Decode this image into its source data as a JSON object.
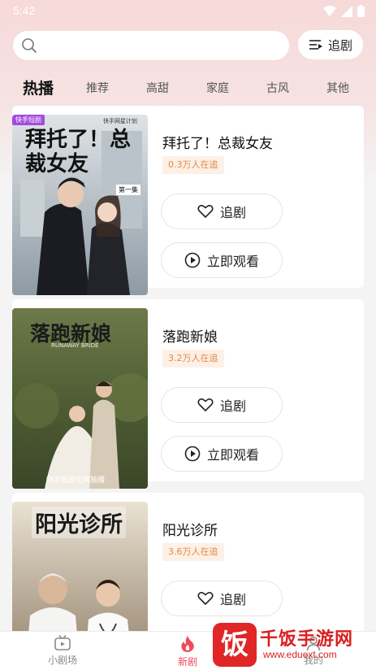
{
  "status_bar": {
    "time": "5:42"
  },
  "search": {
    "placeholder": "",
    "value": ""
  },
  "header": {
    "follow_label": "追剧"
  },
  "tabs": [
    {
      "label": "热播",
      "active": true
    },
    {
      "label": "推荐"
    },
    {
      "label": "高甜"
    },
    {
      "label": "家庭"
    },
    {
      "label": "古风"
    },
    {
      "label": "其他"
    }
  ],
  "dramas": [
    {
      "title": "拜托了！总裁女友",
      "followers": "0.3万人在追",
      "poster_title": "拜托了！总裁女友",
      "poster_tag": "快手短剧",
      "poster_credit": "快手网星计划",
      "poster_episode": "第一集",
      "follow_label": "追剧",
      "watch_label": "立即观看"
    },
    {
      "title": "落跑新娘",
      "followers": "3.2万人在追",
      "poster_title": "落跑新娘",
      "poster_subtitle": "RUNAWAY BRIDE",
      "poster_bottom": "快手短剧全网独播",
      "follow_label": "追剧",
      "watch_label": "立即观看"
    },
    {
      "title": "阳光诊所",
      "followers": "3.6万人在追",
      "poster_title": "阳光诊所",
      "follow_label": "追剧"
    }
  ],
  "tabbar": [
    {
      "label": "小剧场",
      "icon": "tv-icon"
    },
    {
      "label": "新剧",
      "icon": "flame-icon",
      "active": true
    },
    {
      "label": "我的",
      "icon": "user-icon"
    }
  ],
  "watermark": {
    "title": "千饭手游网",
    "url": "www.eduext.com",
    "logo_char": "饭"
  },
  "colors": {
    "accent": "#f04a5a",
    "badge_text": "#e08a46",
    "badge_bg": "#fdf0e6"
  }
}
